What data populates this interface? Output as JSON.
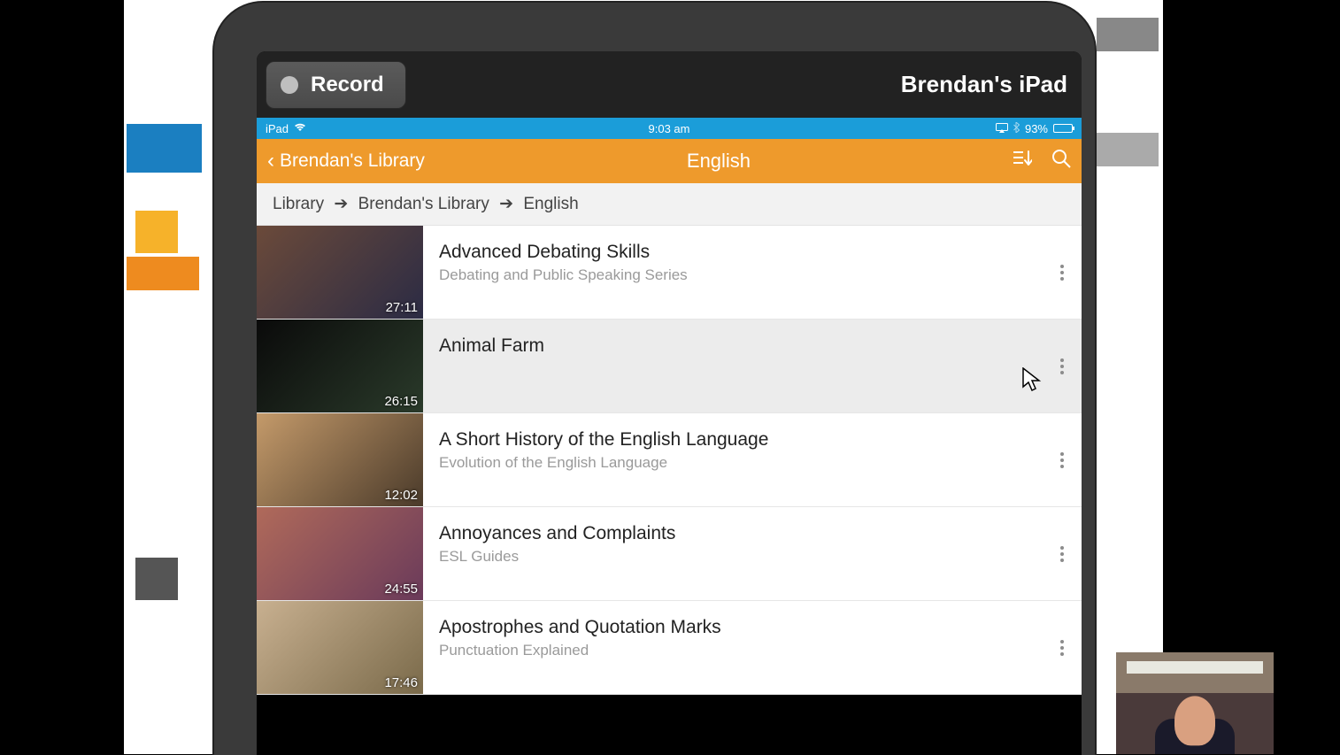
{
  "overlay": {
    "record_label": "Record",
    "device_name": "Brendan's iPad"
  },
  "status": {
    "device": "iPad",
    "time": "9:03 am",
    "battery_pct": "93%"
  },
  "header": {
    "back_label": "Brendan's Library",
    "title": "English"
  },
  "breadcrumb": {
    "root": "Library",
    "level1": "Brendan's Library",
    "level2": "English"
  },
  "videos": [
    {
      "title": "Advanced Debating Skills",
      "subtitle": "Debating and Public Speaking Series",
      "duration": "27:11"
    },
    {
      "title": "Animal Farm",
      "subtitle": "",
      "duration": "26:15"
    },
    {
      "title": "A Short History of the English Language",
      "subtitle": "Evolution of the English Language",
      "duration": "12:02"
    },
    {
      "title": "Annoyances and Complaints",
      "subtitle": "ESL Guides",
      "duration": "24:55"
    },
    {
      "title": "Apostrophes and Quotation Marks",
      "subtitle": "Punctuation Explained",
      "duration": "17:46"
    }
  ]
}
